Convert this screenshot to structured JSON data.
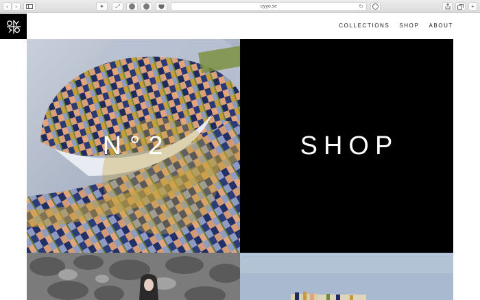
{
  "browser": {
    "url": "oyyo.se",
    "icons": [
      "back-icon",
      "forward-icon",
      "sidebar-icon",
      "extension-icon",
      "fullscreen-icon",
      "circle-icon",
      "pinterest-icon",
      "pocket-icon",
      "reload-icon",
      "info-icon",
      "share-icon",
      "tabs-icon",
      "new-tab-icon"
    ]
  },
  "header": {
    "logo_text": "OYYO",
    "nav": [
      "COLLECTIONS",
      "SHOP",
      "ABOUT"
    ]
  },
  "tiles": {
    "collection_title": "N°2",
    "shop_title": "SHOP"
  },
  "colors": {
    "black": "#000000",
    "mustard": "#b8922a",
    "navy": "#1e2a5e",
    "peach": "#e0a47a",
    "sky": "#a7b8cd"
  }
}
